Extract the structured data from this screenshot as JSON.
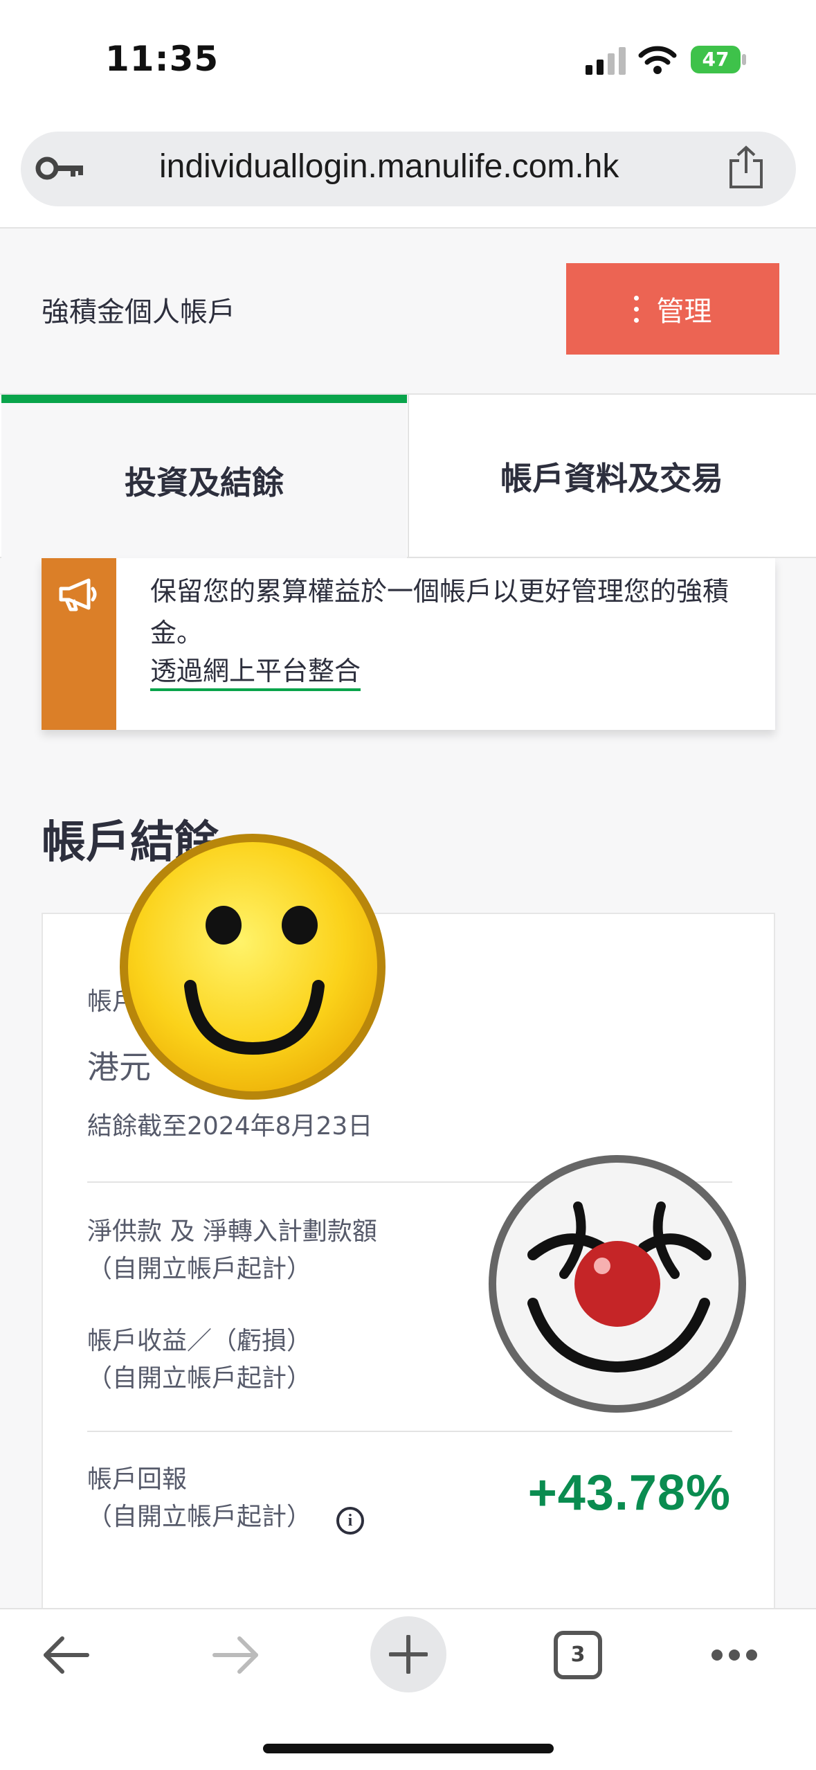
{
  "status_bar": {
    "time": "11:35",
    "battery": "47"
  },
  "browser": {
    "url": "individuallogin.manulife.com.hk",
    "tab_count": "3"
  },
  "header": {
    "title": "強積金個人帳戶",
    "manage_label": "管理"
  },
  "tabs": [
    {
      "label": "投資及結餘",
      "active": true
    },
    {
      "label": "帳戶資料及交易",
      "active": false
    }
  ],
  "notice": {
    "text": "保留您的累算權益於一個帳戶以更好管理您的強積金。",
    "link": "透過網上平台整合"
  },
  "section": {
    "title": "帳戶結餘"
  },
  "balance_card": {
    "balance_label": "帳戶結餘",
    "currency": "港元",
    "as_of": "結餘截至2024年8月23日",
    "net_contrib_label_1": "淨供款 及 淨轉入計劃款額",
    "net_contrib_label_2": "（自開立帳戶起計）",
    "gain_label_1": "帳戶收益／（虧損）",
    "gain_label_2": "（自開立帳戶起計）",
    "return_label_1": "帳戶回報",
    "return_label_2": "（自開立帳戶起計）",
    "return_value": "+43.78%"
  },
  "icons": {
    "key": "key-icon",
    "share": "share-icon",
    "megaphone": "megaphone-icon",
    "info": "info-icon",
    "back": "back-arrow-icon",
    "forward": "forward-arrow-icon",
    "plus": "plus-icon",
    "more": "more-icon"
  },
  "colors": {
    "accent_green": "#09a44b",
    "manage_red": "#ec6453",
    "notice_orange": "#db7f28",
    "return_green": "#0a8c50"
  }
}
